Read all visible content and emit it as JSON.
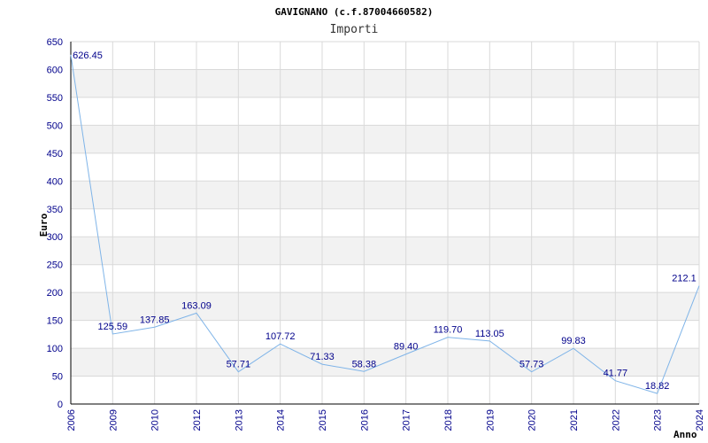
{
  "chart_data": {
    "type": "line",
    "title": "GAVIGNANO (c.f.87004660582)",
    "subtitle": "Importi",
    "ylabel": "Euro",
    "xlabel": "Anno",
    "ylim": [
      0,
      650
    ],
    "yticks": [
      0,
      50,
      100,
      150,
      200,
      250,
      300,
      350,
      400,
      450,
      500,
      550,
      600,
      650
    ],
    "grid": true,
    "categories": [
      "2006",
      "2009",
      "2010",
      "2012",
      "2013",
      "2014",
      "2015",
      "2016",
      "2017",
      "2018",
      "2019",
      "2020",
      "2021",
      "2022",
      "2023",
      "2024"
    ],
    "series": [
      {
        "values": [
          626.45,
          125.59,
          137.85,
          163.09,
          57.71,
          107.72,
          71.33,
          58.38,
          89.4,
          119.7,
          113.05,
          57.73,
          99.83,
          41.77,
          18.82,
          212.1
        ],
        "labels": [
          "626.45",
          "125.59",
          "137.85",
          "163.09",
          "57.71",
          "107.72",
          "71.33",
          "58.38",
          "89.40",
          "119.70",
          "113.05",
          "57.73",
          "99.83",
          "41.77",
          "18.82",
          "212.1"
        ]
      }
    ],
    "colors": {
      "line": "#7fb4e8",
      "band": "#f2f2f2",
      "grid": "#d9d9d9",
      "axis": "#000000",
      "text": "#00008b"
    }
  }
}
